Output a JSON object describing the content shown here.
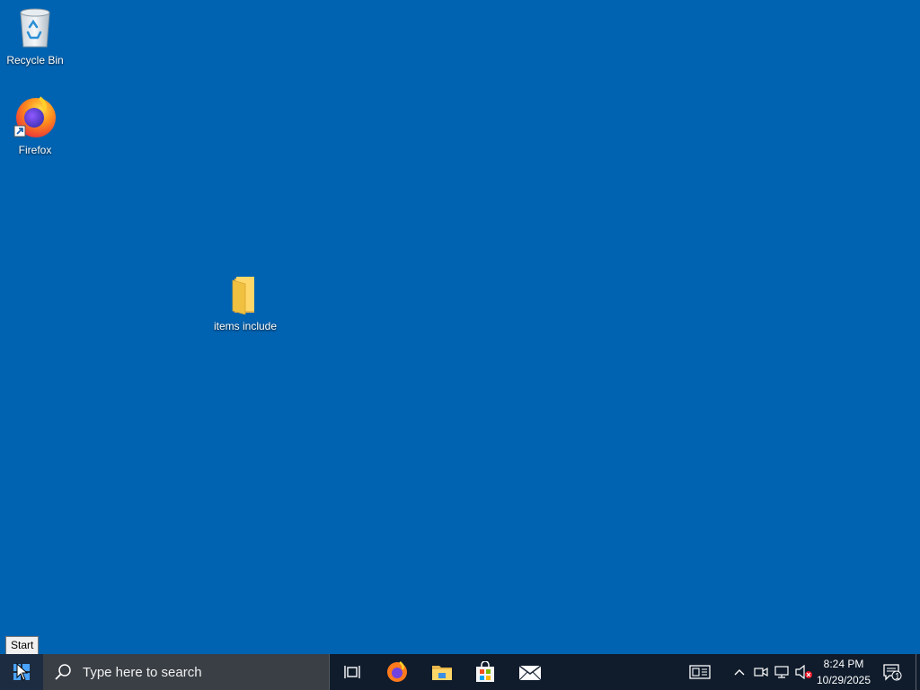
{
  "desktop": {
    "background_color": "#0063b1",
    "icons": {
      "recycle_bin": "Recycle Bin",
      "firefox": "Firefox",
      "folder": "items include"
    }
  },
  "tooltip": {
    "text": "Start"
  },
  "taskbar": {
    "search_placeholder": "Type here to search",
    "pinned": [
      "task-view-icon",
      "firefox-icon",
      "file-explorer-icon",
      "microsoft-store-icon",
      "mail-icon"
    ],
    "tray": [
      "news-and-interests-icon",
      "chevron-up-icon",
      "meet-now-icon",
      "network-icon",
      "volume-muted-icon"
    ],
    "clock": {
      "time": "8:24 PM",
      "date": "10/29/2025"
    },
    "notifications_badge": "1"
  }
}
